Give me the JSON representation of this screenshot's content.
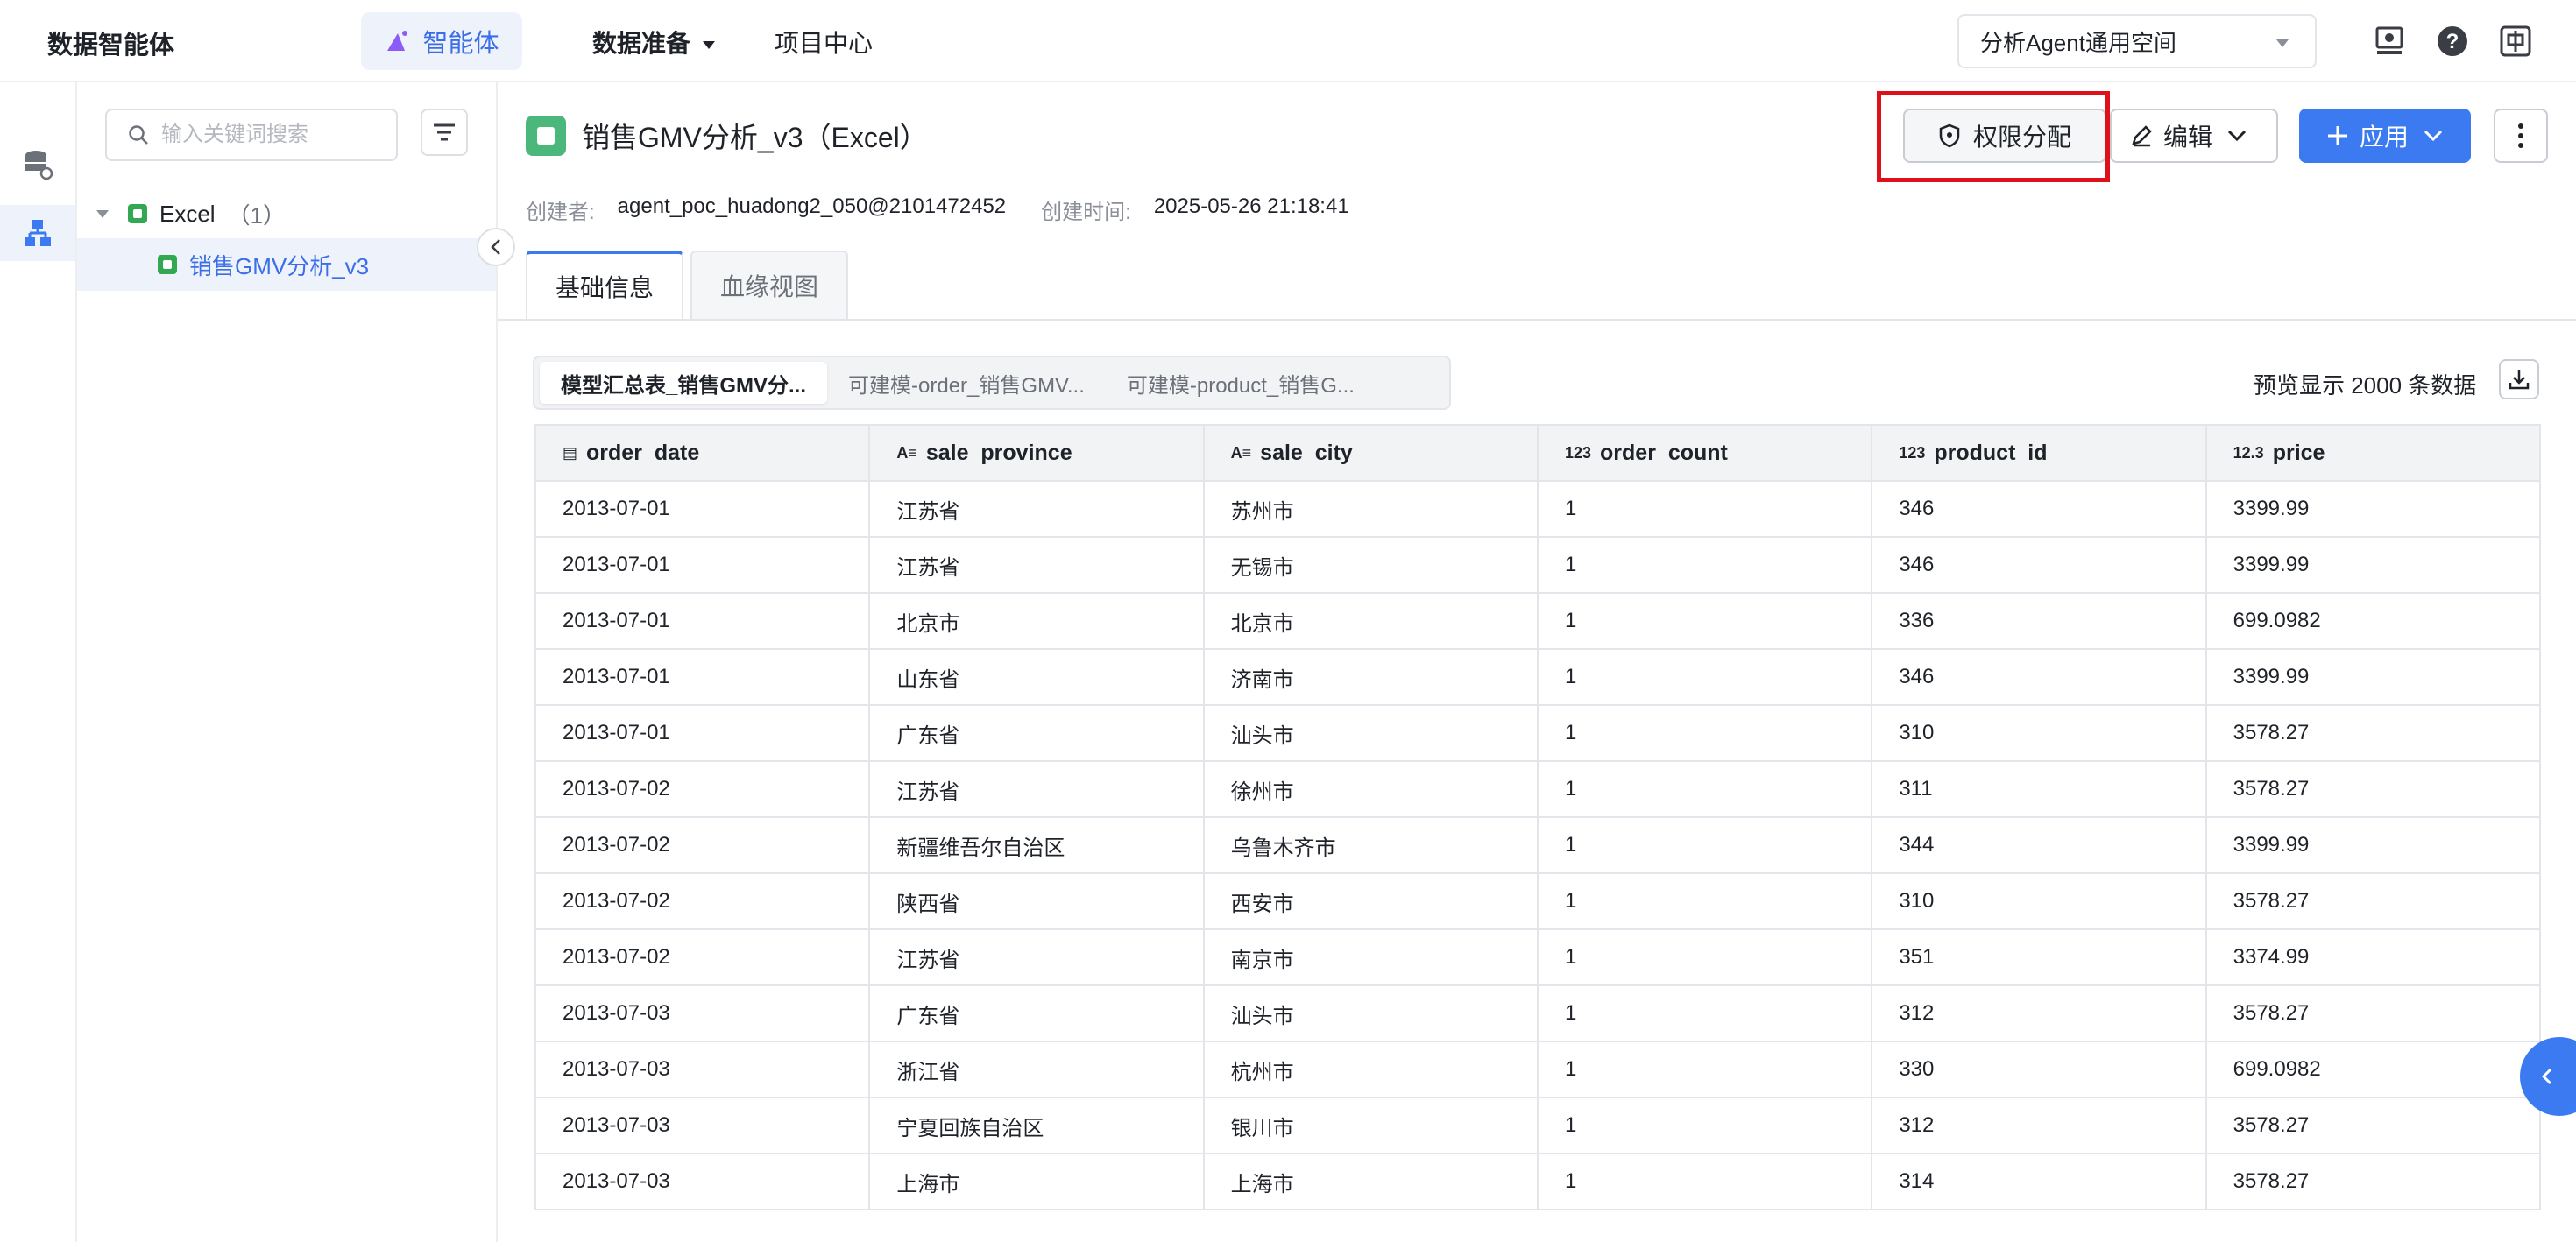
{
  "topbar": {
    "brand": "数据智能体",
    "nav_agent": "智能体",
    "nav_data": "数据准备",
    "nav_project": "项目中心",
    "space": "分析Agent通用空间"
  },
  "tree": {
    "search_placeholder": "输入关键词搜索",
    "root_label": "Excel",
    "root_count": "（1）",
    "leaf_label": "销售GMV分析_v3"
  },
  "header": {
    "title": "销售GMV分析_v3（Excel）",
    "creator_label": "创建者:",
    "creator_value": "agent_poc_huadong2_050@2101472452",
    "created_label": "创建时间:",
    "created_value": "2025-05-26 21:18:41",
    "perm_button": "权限分配",
    "edit_button": "编辑",
    "apply_button": "应用"
  },
  "tabs": [
    "基础信息",
    "血缘视图"
  ],
  "sheets": [
    "模型汇总表_销售GMV分...",
    "可建模-order_销售GMV...",
    "可建模-product_销售G..."
  ],
  "preview": "预览显示 2000 条数据",
  "table": {
    "columns": [
      {
        "icon": "▤",
        "name": "order_date"
      },
      {
        "icon": "A≡",
        "name": "sale_province"
      },
      {
        "icon": "A≡",
        "name": "sale_city"
      },
      {
        "icon": "123",
        "name": "order_count"
      },
      {
        "icon": "123",
        "name": "product_id"
      },
      {
        "icon": "12.3",
        "name": "price"
      }
    ],
    "rows": [
      [
        "2013-07-01",
        "江苏省",
        "苏州市",
        "1",
        "346",
        "3399.99"
      ],
      [
        "2013-07-01",
        "江苏省",
        "无锡市",
        "1",
        "346",
        "3399.99"
      ],
      [
        "2013-07-01",
        "北京市",
        "北京市",
        "1",
        "336",
        "699.0982"
      ],
      [
        "2013-07-01",
        "山东省",
        "济南市",
        "1",
        "346",
        "3399.99"
      ],
      [
        "2013-07-01",
        "广东省",
        "汕头市",
        "1",
        "310",
        "3578.27"
      ],
      [
        "2013-07-02",
        "江苏省",
        "徐州市",
        "1",
        "311",
        "3578.27"
      ],
      [
        "2013-07-02",
        "新疆维吾尔自治区",
        "乌鲁木齐市",
        "1",
        "344",
        "3399.99"
      ],
      [
        "2013-07-02",
        "陕西省",
        "西安市",
        "1",
        "310",
        "3578.27"
      ],
      [
        "2013-07-02",
        "江苏省",
        "南京市",
        "1",
        "351",
        "3374.99"
      ],
      [
        "2013-07-03",
        "广东省",
        "汕头市",
        "1",
        "312",
        "3578.27"
      ],
      [
        "2013-07-03",
        "浙江省",
        "杭州市",
        "1",
        "330",
        "699.0982"
      ],
      [
        "2013-07-03",
        "宁夏回族自治区",
        "银川市",
        "1",
        "312",
        "3578.27"
      ],
      [
        "2013-07-03",
        "上海市",
        "上海市",
        "1",
        "314",
        "3578.27"
      ]
    ]
  },
  "colors": {
    "accent": "#3b7af0",
    "highlight": "#e0101a",
    "excel_green": "#33a853"
  }
}
